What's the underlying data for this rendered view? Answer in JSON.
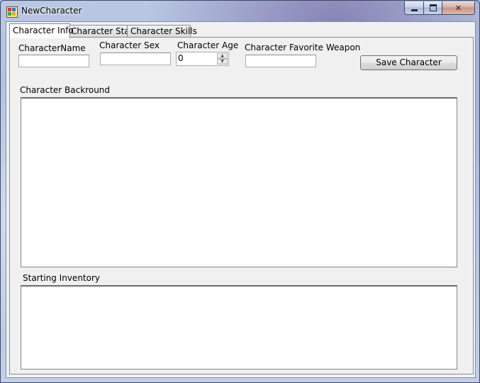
{
  "window": {
    "title": "NewCharacter"
  },
  "tabs": [
    {
      "label": "Character Info",
      "active": true
    },
    {
      "label": "Character Stats",
      "active": false
    },
    {
      "label": "Character Skills",
      "active": false
    }
  ],
  "form": {
    "name_label": "CharacterName",
    "name_value": "",
    "sex_label": "Character Sex",
    "sex_value": "",
    "age_label": "Character Age",
    "age_value": "0",
    "weapon_label": "Character Favorite Weapon",
    "weapon_value": "",
    "save_label": "Save Character",
    "background_label": "Character Backround",
    "background_value": "",
    "inventory_label": "Starting Inventory",
    "inventory_value": ""
  }
}
